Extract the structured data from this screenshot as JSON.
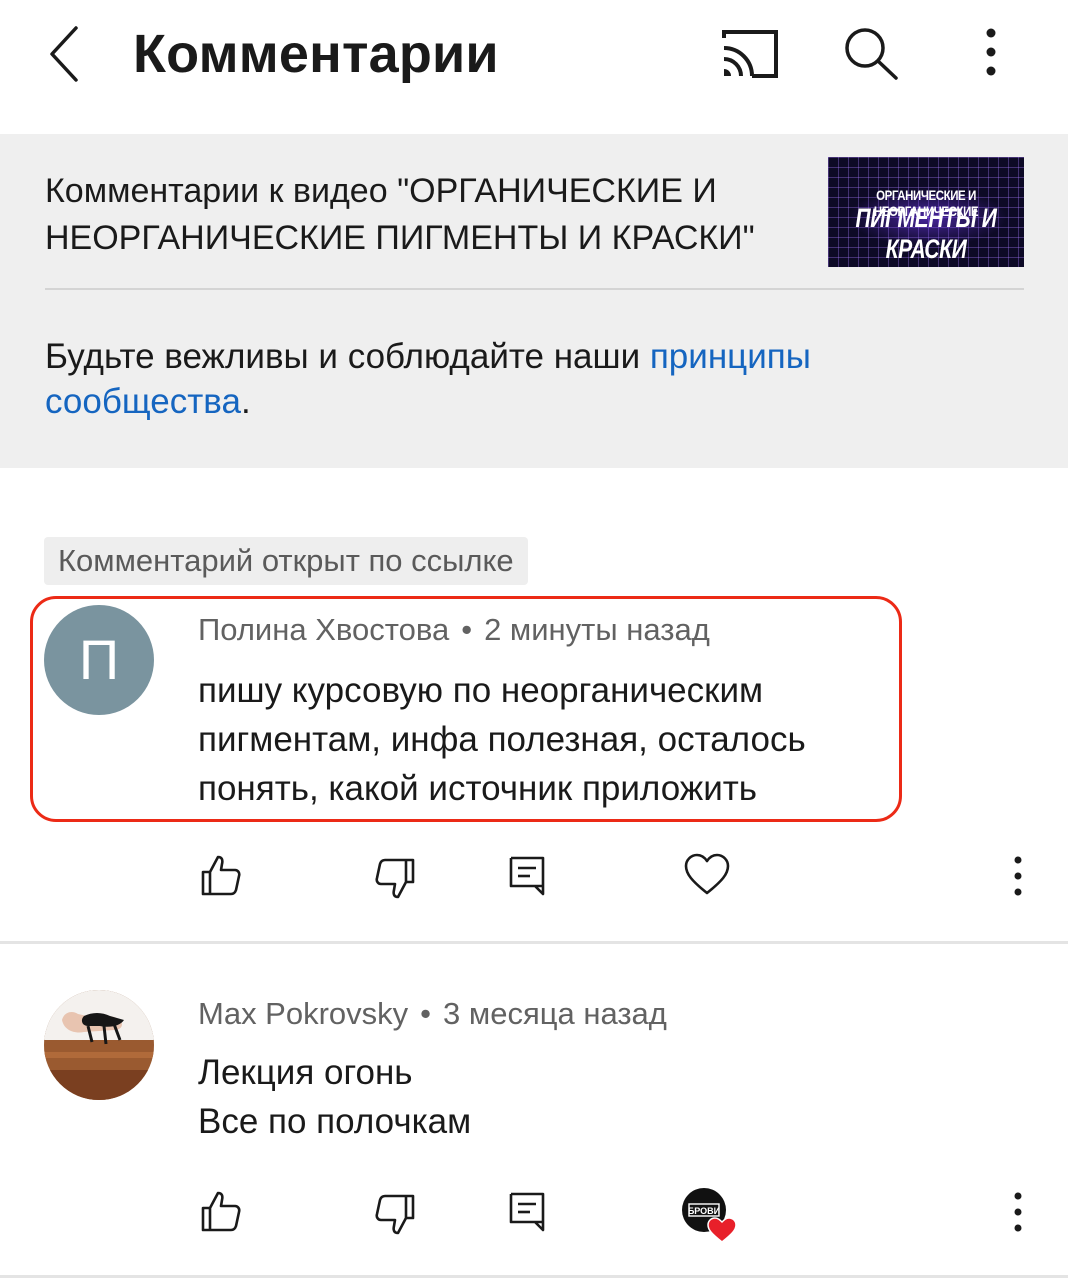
{
  "header": {
    "title": "Комментарии",
    "icons": [
      "back-arrow-icon",
      "cast-icon",
      "search-icon",
      "more-vert-icon"
    ]
  },
  "video": {
    "caption_line1": "Комментарии к видео \"ОРГАНИЧЕСКИЕ И",
    "caption_line2": "НЕОРГАНИЧЕСКИЕ ПИГМЕНТЫ И КРАСКИ\"",
    "thumbnail_line1": "ОРГАНИЧЕСКИЕ И НЕОРГАНИЧЕСКИЕ",
    "thumbnail_line2": "ПИГМЕНТЫ И КРАСКИ"
  },
  "guidelines": {
    "text": "Будьте вежливы и соблюдайте наши ",
    "link_part1": "принципы",
    "link_part2": "сообщества",
    "suffix": "."
  },
  "linked_badge": "Комментарий открыт по ссылке",
  "comments": [
    {
      "avatar_letter": "П",
      "author": "Полина Хвостова",
      "time": "2 минуты назад",
      "lines": [
        "пишу курсовую по неорганическим",
        "пигментам, инфа полезная, осталось",
        "понять, какой источник приложить"
      ],
      "highlighted": true
    },
    {
      "author": "Max Pokrovsky",
      "time": "3 месяца назад",
      "lines": [
        "Лекция огонь",
        "Все по полочкам"
      ],
      "creator_avatar_text": "БРОВИ",
      "creator_hearted": true
    }
  ],
  "colors": {
    "link": "#1565c0",
    "highlight_border": "#ec2a16",
    "panel_bg": "#efefef",
    "avatar_bg": "#7a949f",
    "heart": "#e8202a"
  }
}
